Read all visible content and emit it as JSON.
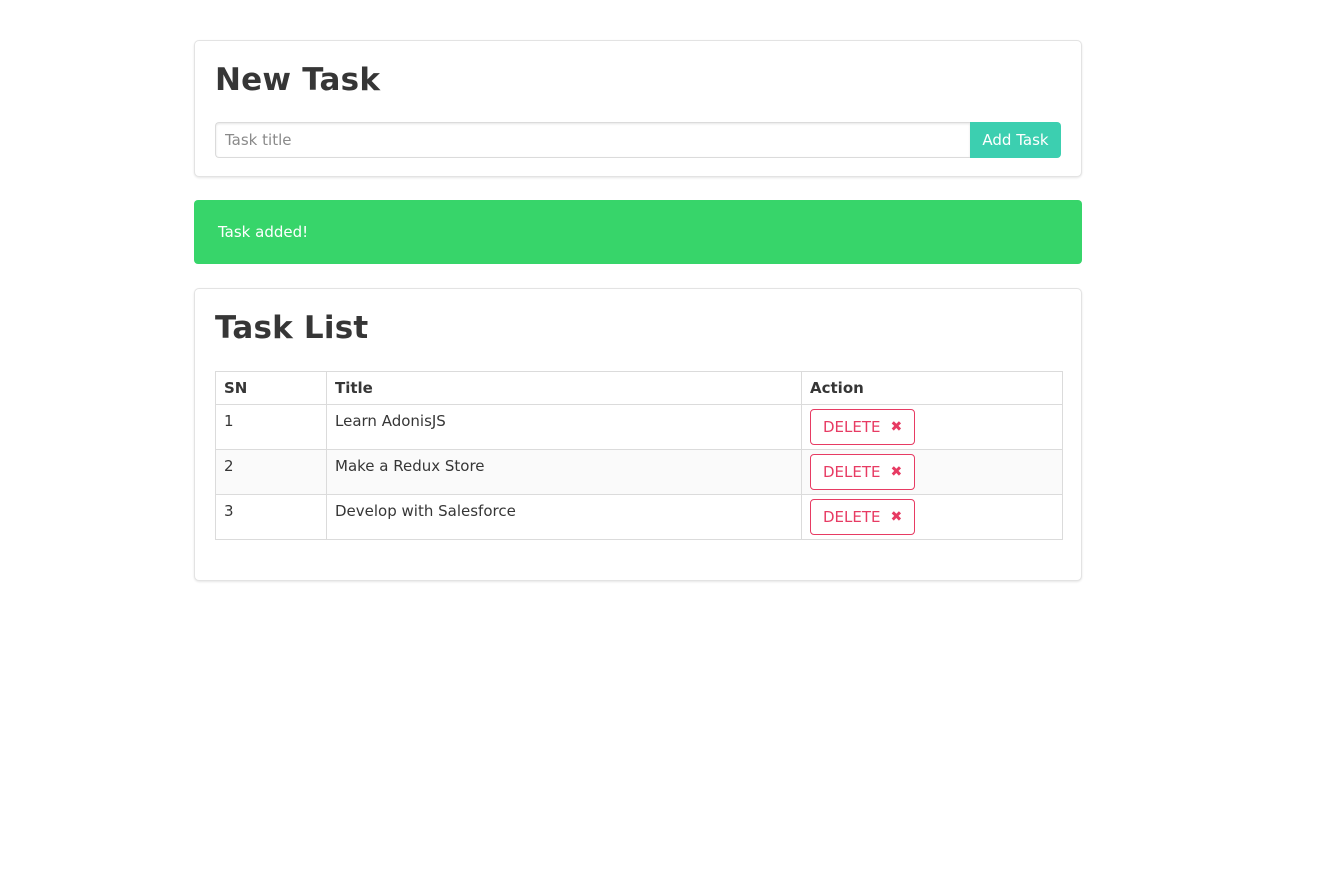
{
  "new_task": {
    "heading": "New Task",
    "input_placeholder": "Task title",
    "input_value": "",
    "add_button_label": "Add Task"
  },
  "notification": {
    "message": "Task added!"
  },
  "task_list": {
    "heading": "Task List",
    "columns": [
      "SN",
      "Title",
      "Action"
    ],
    "rows": [
      {
        "sn": "1",
        "title": "Learn AdonisJS",
        "action_label": "DELETE"
      },
      {
        "sn": "2",
        "title": "Make a Redux Store",
        "action_label": "DELETE"
      },
      {
        "sn": "3",
        "title": "Develop with Salesforce",
        "action_label": "DELETE"
      }
    ]
  },
  "icons": {
    "delete_icon": "close-icon"
  },
  "colors": {
    "primary": "#3ccfb0",
    "success": "#37d56a",
    "danger": "#e73b63"
  }
}
